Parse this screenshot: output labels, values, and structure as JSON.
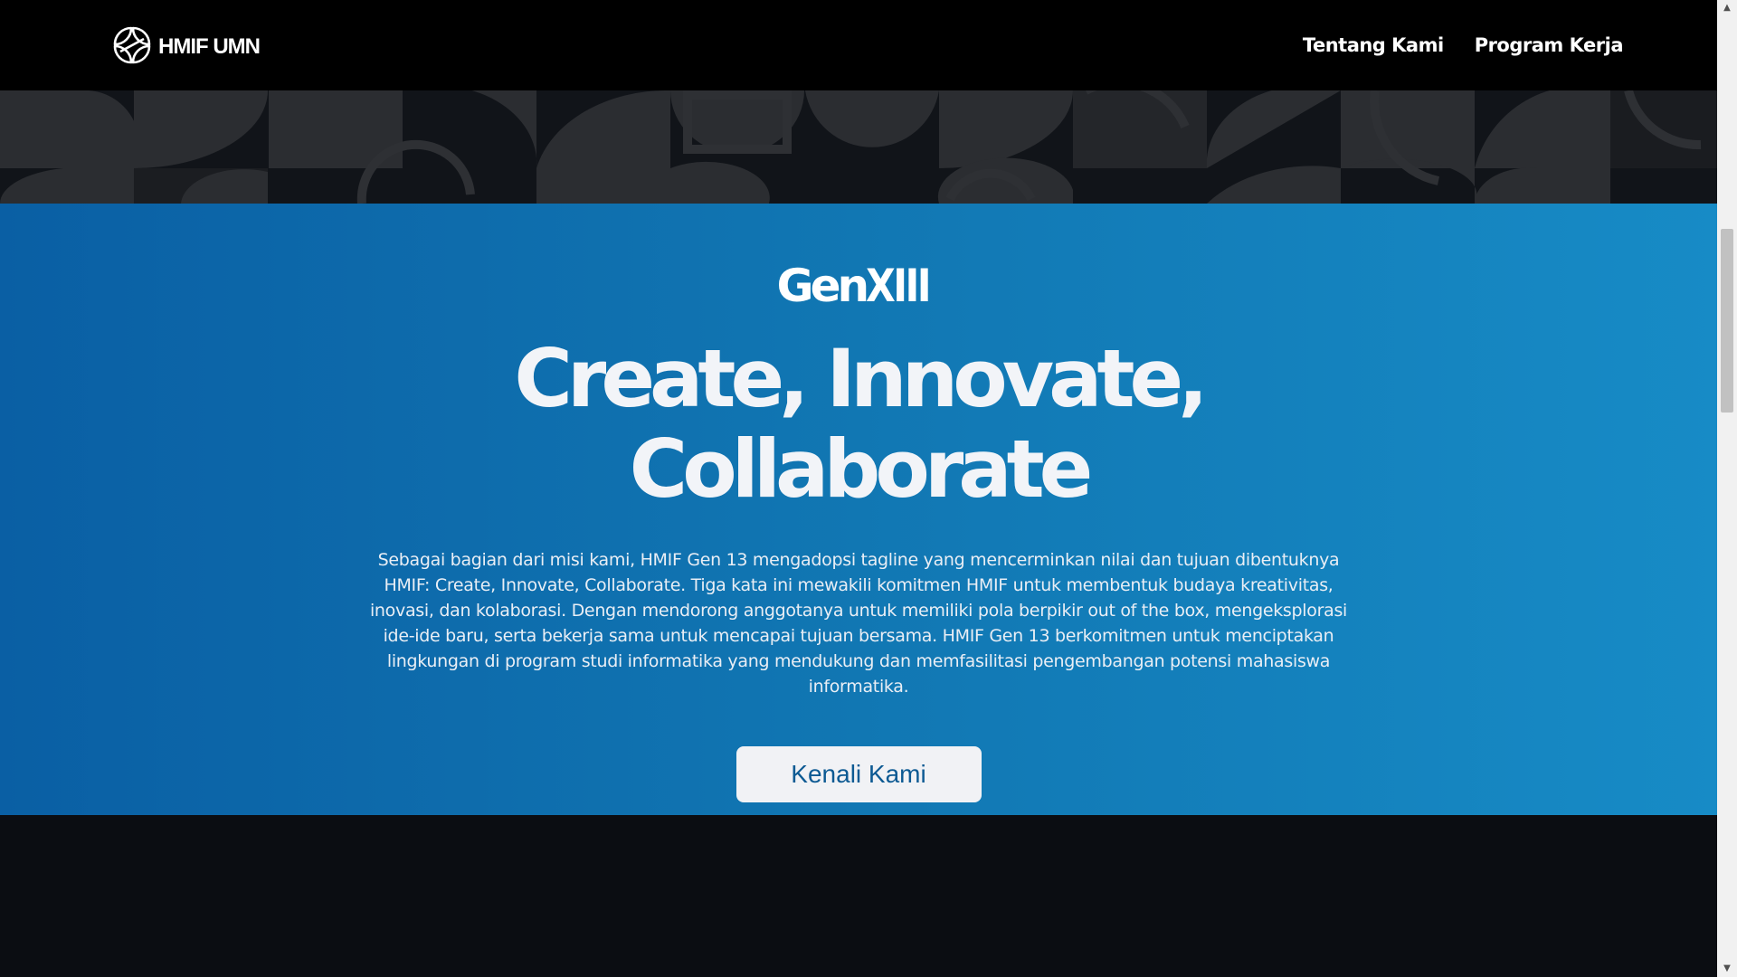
{
  "navbar": {
    "brand_text": "HMIF UMN",
    "links": [
      {
        "label": "Tentang Kami"
      },
      {
        "label": "Program Kerja"
      }
    ]
  },
  "hero": {
    "logo_word": "Gen",
    "logo_numeral": "XIII",
    "title_line1": "Create, Innovate,",
    "title_line2": "Collaborate",
    "description": "Sebagai bagian dari misi kami, HMIF Gen 13 mengadopsi tagline yang mencerminkan nilai dan tujuan dibentuknya HMIF: Create, Innovate, Collaborate. Tiga kata ini mewakili komitmen HMIF untuk membentuk budaya kreativitas, inovasi, dan kolaborasi. Dengan mendorong anggotanya untuk memiliki pola berpikir out of the box, mengeksplorasi ide-ide baru, serta bekerja sama untuk mencapai tujuan bersama. HMIF Gen 13 berkomitmen untuk menciptakan lingkungan di program studi informatika yang mendukung dan memfasilitasi pengembangan potensi mahasiswa informatika.",
    "cta_label": "Kenali Kami"
  },
  "colors": {
    "navbar_bg": "#000000",
    "hero_gradient_start": "#0a5fa4",
    "hero_gradient_end": "#178bc6",
    "page_bg": "#0b0d12",
    "cta_text": "#0d5a93"
  },
  "icons": {
    "brand_logo": "hmif-leaf-logo-icon",
    "scroll_up": "triangle-up-icon",
    "scroll_down": "triangle-down-icon"
  }
}
